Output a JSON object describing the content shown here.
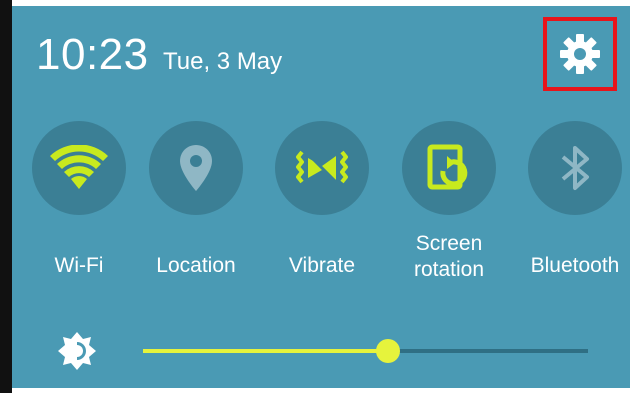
{
  "status": {
    "time": "10:23",
    "date": "Tue, 3 May"
  },
  "settings": {
    "icon": "gear-icon"
  },
  "toggles": [
    {
      "label": "Wi-Fi",
      "icon": "wifi-icon",
      "active": true
    },
    {
      "label": "Location",
      "icon": "location-pin-icon",
      "active": false
    },
    {
      "label": "Vibrate",
      "icon": "vibrate-icon",
      "active": true
    },
    {
      "label": "Screen\nrotation",
      "label_line1": "Screen",
      "label_line2": "rotation",
      "icon": "screen-rotation-icon",
      "active": true
    },
    {
      "label": "Bluetooth",
      "icon": "bluetooth-icon",
      "active": false
    }
  ],
  "brightness": {
    "icon": "brightness-icon",
    "level": 0.55
  },
  "colors": {
    "panel": "#4a9ab4",
    "tile": "#3b7f95",
    "accent": "#c8ea1e",
    "inactive_icon": "#8fb7c5",
    "highlight_box": "#e8141b"
  }
}
